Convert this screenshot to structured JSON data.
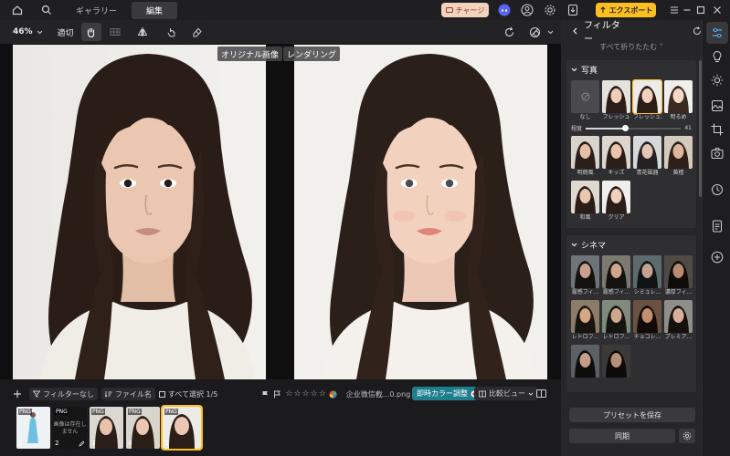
{
  "topbar": {
    "tabs": [
      {
        "label": "ギャラリー",
        "active": false
      },
      {
        "label": "編集",
        "active": true
      }
    ],
    "charge_label": "チャージ",
    "export_label": "エクスポート"
  },
  "toolbar": {
    "zoom": "46%",
    "fit": "適切"
  },
  "canvas": {
    "original_label": "オリジナル画像",
    "rendered_label": "レンダリング"
  },
  "bottombar": {
    "filter_label": "フィルターなし",
    "filename_label": "ファイル名",
    "select_all_label": "すべて選択 1/5",
    "filename": "企业微信截...0.png",
    "realtime_label": "即時カラー調整",
    "compare_label": "比較ビュー",
    "stars": [
      "☆",
      "☆",
      "☆",
      "☆",
      "☆"
    ]
  },
  "filmstrip": [
    {
      "badge": "PNG",
      "num": "1",
      "error": ""
    },
    {
      "badge": "PNG",
      "num": "2",
      "error": "画像は存在しません"
    },
    {
      "badge": "PNG",
      "num": "3",
      "error": ""
    },
    {
      "badge": "PNG",
      "num": "4",
      "error": ""
    },
    {
      "badge": "PNG",
      "num": "5",
      "error": ""
    }
  ],
  "panel": {
    "title": "フィルター",
    "collapse_all": "すべて折りたたむ ˄",
    "photo_section": {
      "title": "写真",
      "row1": [
        "なし",
        "フレッシュ",
        "フレッシュ2",
        "明るめ"
      ],
      "intensity_label": "程度",
      "intensity_value": "41",
      "intensity": 0.41,
      "row2": [
        "明朗風",
        "キッズ",
        "青花磁器",
        "黄檀"
      ],
      "row3": [
        "和風",
        "クリア"
      ]
    },
    "cinema_section": {
      "title": "シネマ",
      "row1": [
        "霧感フィ...",
        "霧感フィ...",
        "シミュレ...",
        "濃厚フィ..."
      ],
      "row2": [
        "レトロフ...",
        "レトロフ...",
        "チョコレ...",
        "プレミア..."
      ],
      "row3": [
        "",
        ""
      ]
    },
    "save_preset": "プリセットを保存",
    "sync": "同期"
  },
  "colors": {
    "accent": "#ffc01f",
    "realtime": "#1d7f8e",
    "bg": "#1b1b1d"
  }
}
